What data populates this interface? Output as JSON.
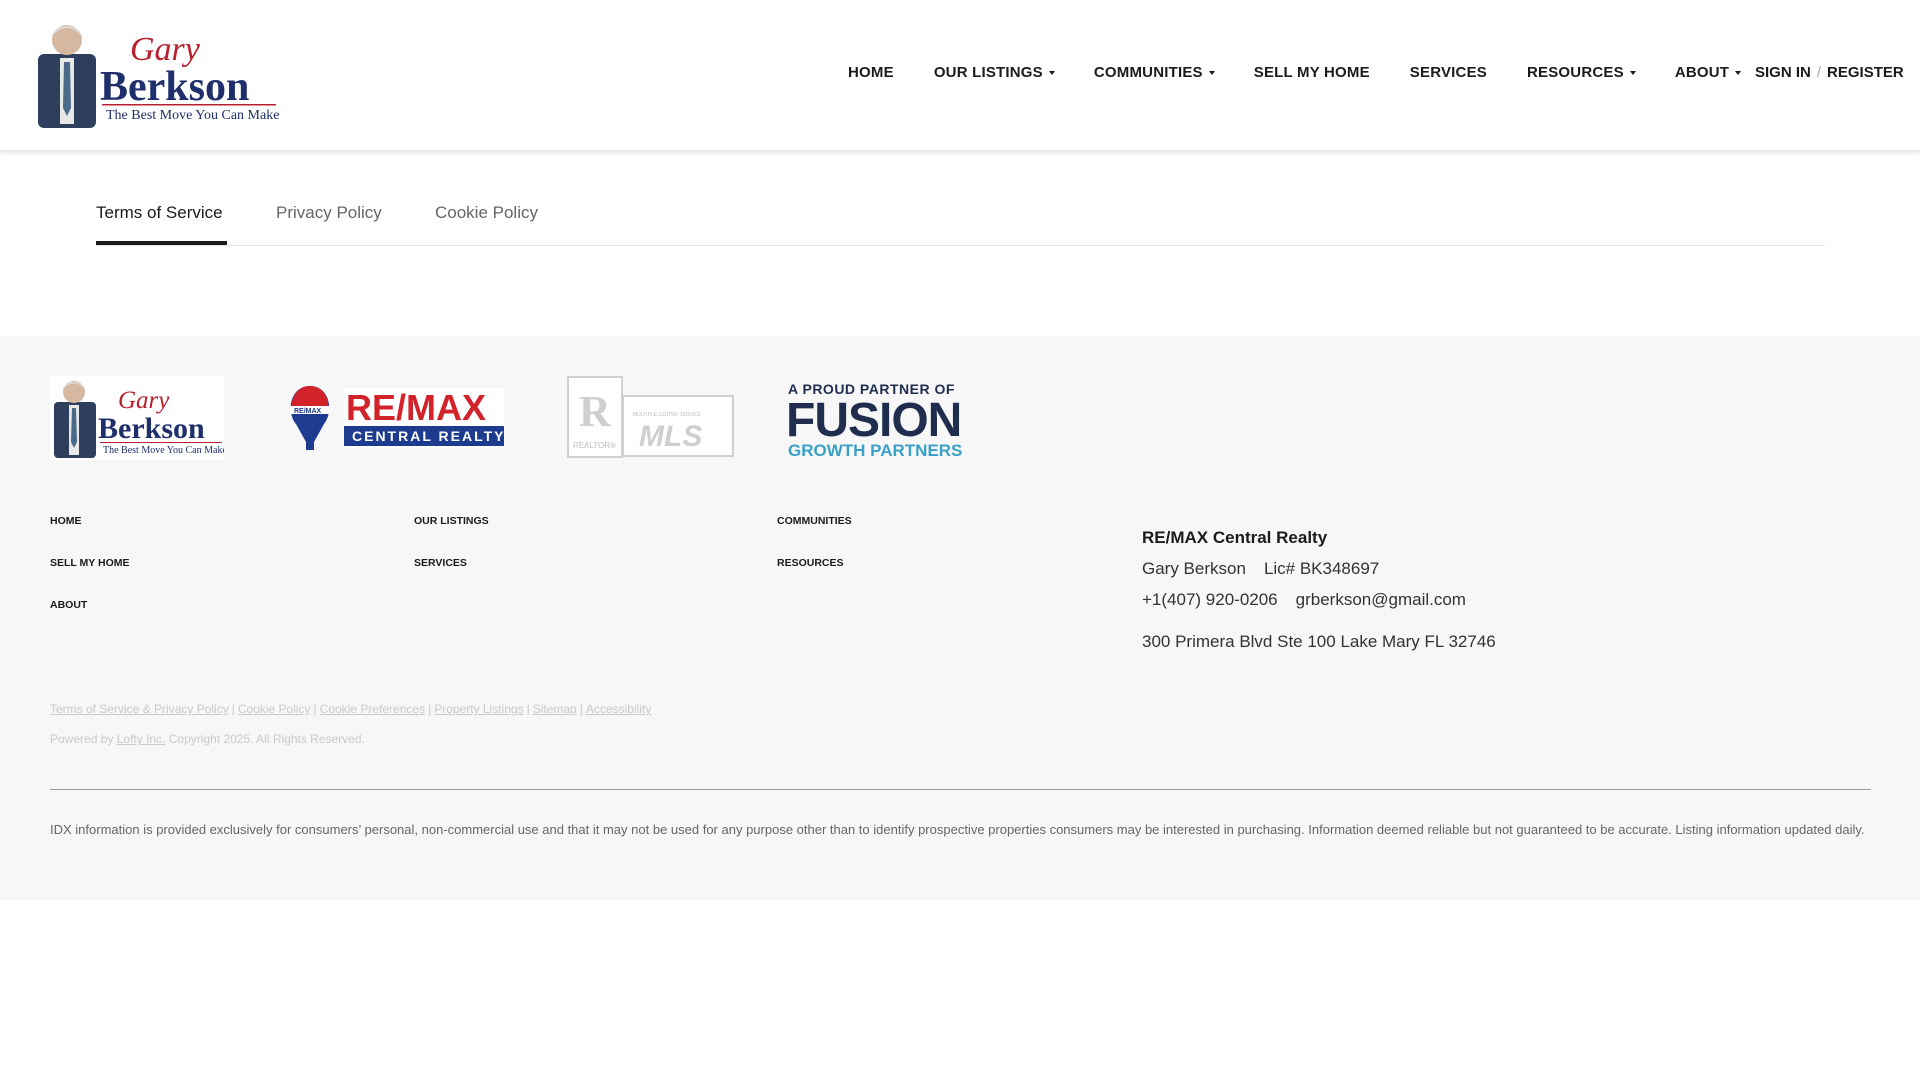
{
  "header": {
    "logo": {
      "name_top": "Gary",
      "name_main": "Berkson",
      "tagline": "The Best Move You Can Make!"
    },
    "nav": [
      {
        "label": "HOME",
        "dropdown": false
      },
      {
        "label": "OUR LISTINGS",
        "dropdown": true
      },
      {
        "label": "COMMUNITIES",
        "dropdown": true
      },
      {
        "label": "SELL MY HOME",
        "dropdown": false
      },
      {
        "label": "SERVICES",
        "dropdown": false
      },
      {
        "label": "RESOURCES",
        "dropdown": true
      },
      {
        "label": "ABOUT",
        "dropdown": true
      }
    ],
    "sign_in": "SIGN IN",
    "separator": "/",
    "register": "REGISTER"
  },
  "tabs": [
    {
      "label": "Terms of Service",
      "active": true
    },
    {
      "label": "Privacy Policy",
      "active": false
    },
    {
      "label": "Cookie Policy",
      "active": false
    }
  ],
  "footer": {
    "logos": {
      "gary": {
        "name_top": "Gary",
        "name_main": "Berkson",
        "tagline": "The Best Move You Can Make!"
      },
      "remax": {
        "badge": "RE/MAX",
        "main": "RE/MAX",
        "sub": "CENTRAL REALTY"
      },
      "mls": {
        "realtor": "REALTOR®",
        "mls_top": "MULTIPLE LISTING SERVICE",
        "mls_main": "MLS"
      },
      "fusion": {
        "top": "A PROUD PARTNER OF",
        "main": "FUSION",
        "bottom": "GROWTH PARTNERS"
      }
    },
    "links": [
      {
        "label": "HOME"
      },
      {
        "label": "OUR LISTINGS"
      },
      {
        "label": "COMMUNITIES"
      },
      {
        "label": "SELL MY HOME"
      },
      {
        "label": "SERVICES"
      },
      {
        "label": "RESOURCES"
      },
      {
        "label": "ABOUT"
      }
    ],
    "contact": {
      "company": "RE/MAX Central Realty",
      "agent": "Gary Berkson",
      "license": "Lic# BK348697",
      "phone": "+1(407) 920-0206",
      "email": "grberkson@gmail.com",
      "address": "300 Primera Blvd Ste 100 Lake Mary FL 32746"
    },
    "legal_links": [
      "Terms of Service & Privacy Policy",
      "Cookie Policy",
      "Cookie Preferences",
      "Property Listings",
      "Sitemap",
      "Accessibility"
    ],
    "legal_separator": "|",
    "powered_prefix": "Powered by",
    "powered_link": "Lofty Inc.",
    "powered_suffix": "Copyright 2025. All Rights Reserved.",
    "idx_text": "IDX information is provided exclusively for consumers’ personal, non-commercial use and that it may not be used for any purpose other than to identify prospective properties consumers may be interested in purchasing. Information deemed reliable but not guaranteed to be accurate. Listing information updated daily."
  },
  "colors": {
    "brand_red": "#b8202e",
    "brand_navy": "#1f2f6b",
    "remax_red": "#d2232a",
    "remax_blue": "#1d3c8f",
    "fusion_navy": "#1f2d4e",
    "fusion_teal": "#3aa1c6"
  }
}
